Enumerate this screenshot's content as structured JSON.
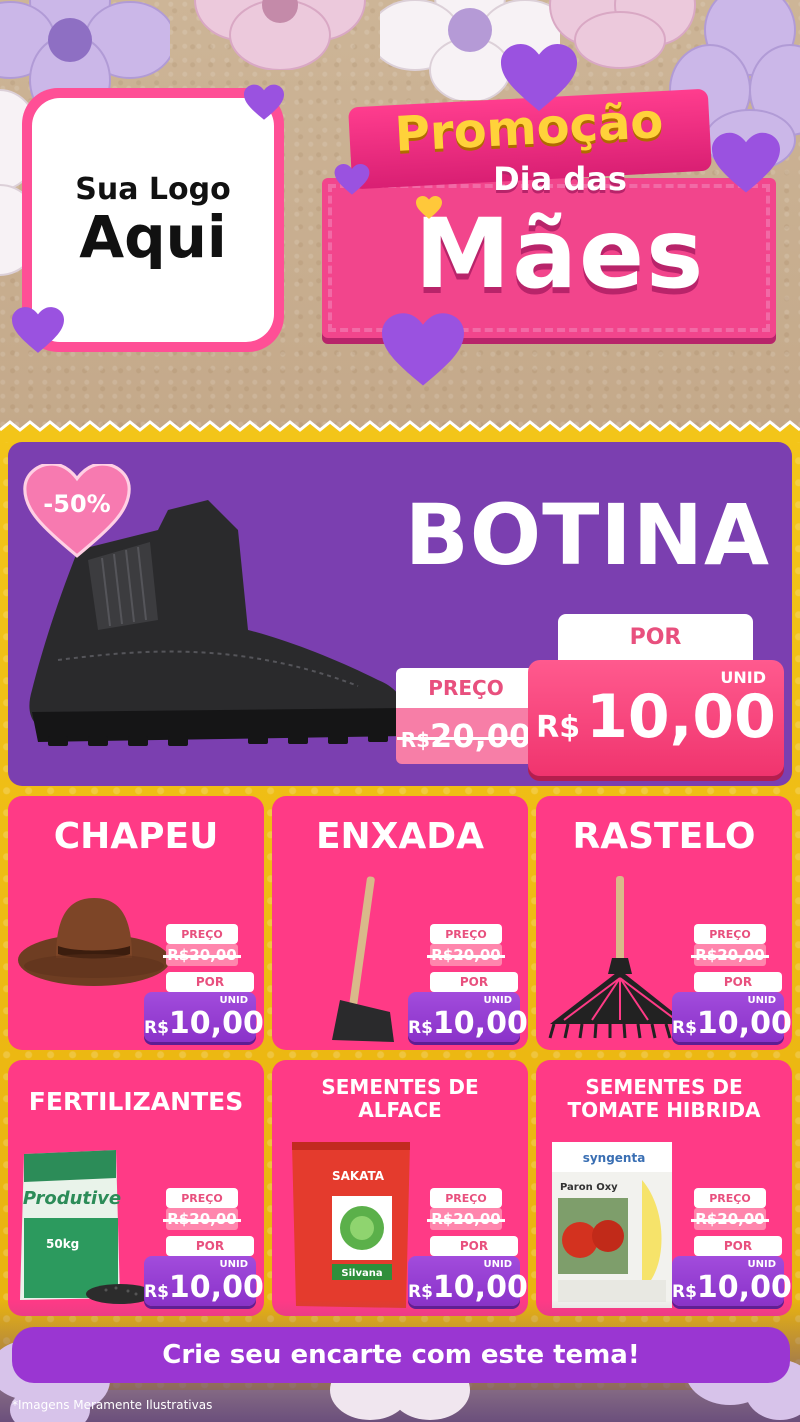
{
  "logo": {
    "line1": "Sua Logo",
    "line2": "Aqui"
  },
  "promo": {
    "line1": "Promoção",
    "line2": "Dia das",
    "line3": "Mães"
  },
  "hero": {
    "title": "BOTINA",
    "discount": "-50%",
    "old_label": "PREÇO",
    "old_currency": "R$",
    "old_amount": "20,00",
    "new_label": "POR",
    "unit": "UNID",
    "new_currency": "R$",
    "new_amount": "10,00"
  },
  "products": [
    {
      "title": "CHAPEU",
      "old_label": "PREÇO",
      "old_price": "R$20,00",
      "new_label": "POR",
      "unit": "UNID",
      "currency": "R$",
      "amount": "10,00"
    },
    {
      "title": "ENXADA",
      "old_label": "PREÇO",
      "old_price": "R$20,00",
      "new_label": "POR",
      "unit": "UNID",
      "currency": "R$",
      "amount": "10,00"
    },
    {
      "title": "RASTELO",
      "old_label": "PREÇO",
      "old_price": "R$20,00",
      "new_label": "POR",
      "unit": "UNID",
      "currency": "R$",
      "amount": "10,00"
    },
    {
      "title": "FERTILIZANTES",
      "old_label": "PREÇO",
      "old_price": "R$20,00",
      "new_label": "POR",
      "unit": "UNID",
      "currency": "R$",
      "amount": "10,00",
      "bag_brand": "Produtive",
      "bag_weight": "50kg"
    },
    {
      "title_l1": "SEMENTES DE",
      "title_l2": "ALFACE",
      "old_label": "PREÇO",
      "old_price": "R$20,00",
      "new_label": "POR",
      "unit": "UNID",
      "currency": "R$",
      "amount": "10,00",
      "pack_brand": "SAKATA",
      "pack_variety": "Silvana"
    },
    {
      "title_l1": "SEMENTES DE",
      "title_l2": "TOMATE HIBRIDA",
      "old_label": "PREÇO",
      "old_price": "R$20,00",
      "new_label": "POR",
      "unit": "UNID",
      "currency": "R$",
      "amount": "10,00",
      "pack_brand": "syngenta",
      "pack_variety": "Paron Oxy"
    }
  ],
  "cta": "Crie seu encarte com este tema!",
  "disclaimer": "*Imagens Meramente Ilustrativas",
  "colors": {
    "pink": "#ff3a86",
    "purple": "#7b3fb0",
    "yellow": "#f3c519",
    "button_purple": "#9a36d2"
  },
  "icons": [
    "heart-icon",
    "flower-icon"
  ]
}
